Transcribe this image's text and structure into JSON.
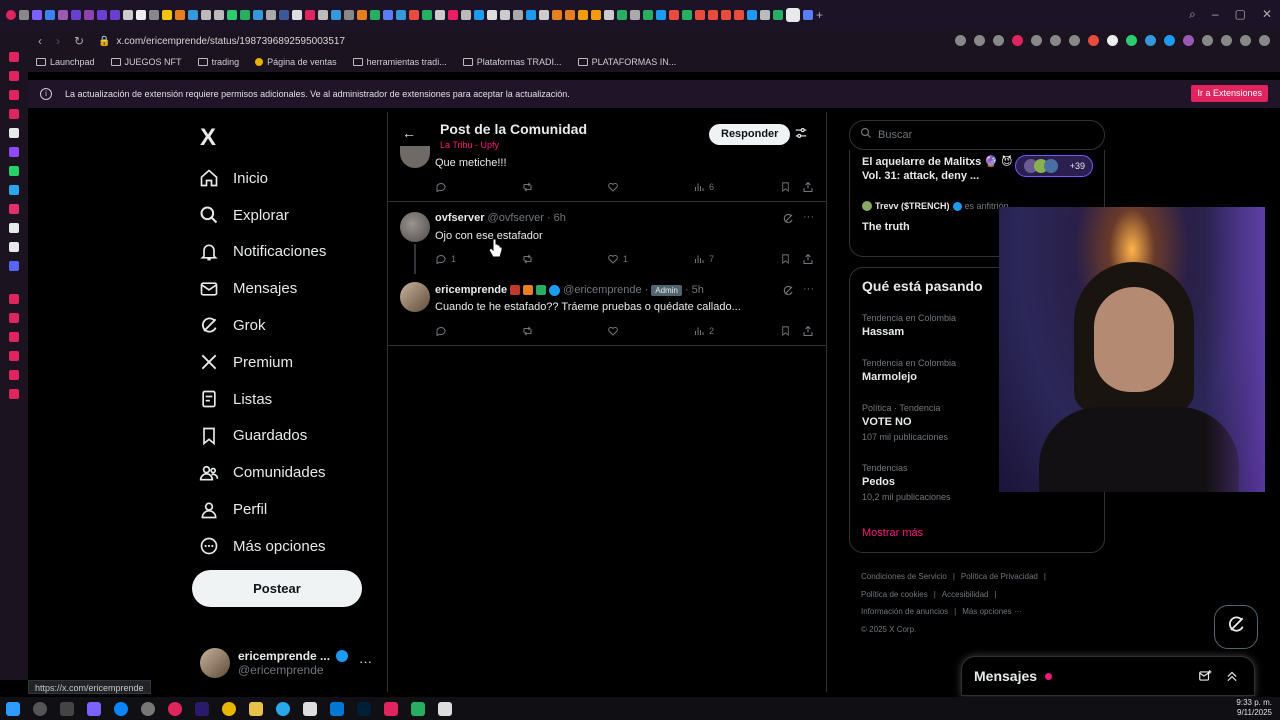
{
  "browser": {
    "url": "x.com/ericemprende/status/1987396892595003517",
    "bookmarks": [
      "Launchpad",
      "JUEGOS NFT",
      "trading",
      "Página de ventas",
      "herramientas tradi...",
      "Plataformas TRADI...",
      "PLATAFORMAS IN..."
    ],
    "infobar_message": "La actualización de extensión requiere permisos adicionales. Ve al administrador de extensiones para aceptar la actualización.",
    "infobar_button": "Ir a Extensiones",
    "status_url": "https://x.com/ericemprende"
  },
  "nav": {
    "logo": "X",
    "items": [
      {
        "label": "Inicio",
        "icon": "home-icon"
      },
      {
        "label": "Explorar",
        "icon": "search-icon"
      },
      {
        "label": "Notificaciones",
        "icon": "bell-icon"
      },
      {
        "label": "Mensajes",
        "icon": "envelope-icon"
      },
      {
        "label": "Grok",
        "icon": "grok-icon"
      },
      {
        "label": "Premium",
        "icon": "x-logo-icon"
      },
      {
        "label": "Listas",
        "icon": "list-icon"
      },
      {
        "label": "Guardados",
        "icon": "bookmark-icon"
      },
      {
        "label": "Comunidades",
        "icon": "people-icon"
      },
      {
        "label": "Perfil",
        "icon": "person-icon"
      },
      {
        "label": "Más opciones",
        "icon": "more-circle-icon"
      }
    ],
    "post_button": "Postear",
    "account": {
      "name": "ericemprende ...",
      "handle": "@ericemprende",
      "more": "···"
    }
  },
  "header": {
    "back": "←",
    "title": "Post de la Comunidad",
    "subtitle": "La Tribu - Upfy",
    "reply_button": "Responder"
  },
  "tweets": [
    {
      "text": "Que metiche!!!",
      "replies": "",
      "reposts": "",
      "likes": "",
      "views": "6"
    },
    {
      "name": "ovfserver",
      "handle": "@ovfserver",
      "time": "· 6h",
      "text": "Ojo con ese estafador",
      "replies": "1",
      "reposts": "",
      "likes": "1",
      "views": "7"
    },
    {
      "name": "ericemprende",
      "handle": "@ericemprende",
      "badge": "Admin",
      "time": "· 5h",
      "text": "Cuando te he estafado?? Tráeme pruebas o quédate callado...",
      "replies": "",
      "reposts": "",
      "likes": "",
      "views": "2"
    }
  ],
  "right": {
    "search_placeholder": "Buscar",
    "space": {
      "title": "El aquelarre de Malitxs 🔮 😈 Vol. 31: attack, deny ...",
      "listeners": "+39",
      "host_name": "Trevv ($TRENCH)",
      "host_role": "es anfitrión",
      "subtitle": "The truth"
    },
    "trends_title": "Qué está pasando",
    "trends": [
      {
        "context": "Tendencia en Colombia",
        "name": "Hassam",
        "count": ""
      },
      {
        "context": "Tendencia en Colombia",
        "name": "Marmolejo",
        "count": ""
      },
      {
        "context": "Política · Tendencia",
        "name": "VOTE NO",
        "count": "107 mil publicaciones"
      },
      {
        "context": "Tendencias",
        "name": "Pedos",
        "count": "10,2 mil publicaciones"
      }
    ],
    "show_more": "Mostrar más",
    "footer": [
      "Condiciones de Servicio",
      "Política de Privacidad",
      "Política de cookies",
      "Accesibilidad",
      "Información de anuncios",
      "Más opciones ···",
      "© 2025 X Corp."
    ]
  },
  "messages_drawer": {
    "title": "Mensajes"
  },
  "taskbar": {
    "time": "9:33 p. m.",
    "date": "9/11/2025"
  },
  "colors": {
    "accent": "#f91880",
    "verified": "#1d9bf0",
    "background": "#000000",
    "divider": "#2f3336",
    "muted": "#71767b"
  }
}
